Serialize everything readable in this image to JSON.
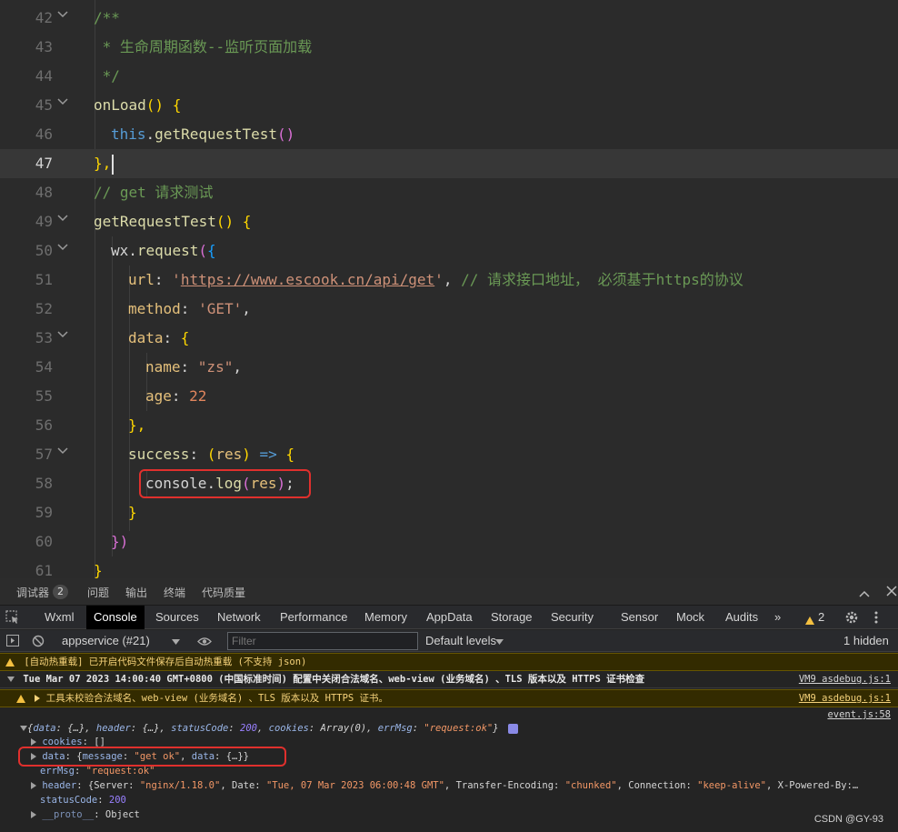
{
  "editor": {
    "lines": [
      {
        "num": "42",
        "folded": true
      },
      {
        "num": "43"
      },
      {
        "num": "44"
      },
      {
        "num": "45",
        "folded": true
      },
      {
        "num": "46"
      },
      {
        "num": "47",
        "current": true
      },
      {
        "num": "48"
      },
      {
        "num": "49",
        "folded": true
      },
      {
        "num": "50",
        "folded": true
      },
      {
        "num": "51"
      },
      {
        "num": "52"
      },
      {
        "num": "53",
        "folded": true
      },
      {
        "num": "54"
      },
      {
        "num": "55"
      },
      {
        "num": "56"
      },
      {
        "num": "57",
        "folded": true
      },
      {
        "num": "58"
      },
      {
        "num": "59"
      },
      {
        "num": "60"
      },
      {
        "num": "61"
      }
    ],
    "code": {
      "l42": "/**",
      "l43": " * 生命周期函数--监听页面加载",
      "l44": " */",
      "l45_fn": "onLoad",
      "l45_rest": "() {",
      "l46_this": "this",
      "l46_fn": "getRequestTest",
      "l46_rest": "()",
      "l47": "},",
      "l48": "// get 请求测试",
      "l49_fn": "getRequestTest",
      "l49_rest": "() {",
      "l50_obj": "wx",
      "l50_fn": "request",
      "l50_rest": "({",
      "l51_key": "url",
      "l51_url": "https://www.escook.cn/api/get",
      "l51_comment": "// 请求接口地址， 必须基于https的协议",
      "l52_key": "method",
      "l52_val": "'GET'",
      "l53_key": "data",
      "l54_key": "name",
      "l54_val": "\"zs\"",
      "l55_key": "age",
      "l55_val": "22",
      "l56": "},",
      "l57_key": "success",
      "l57_param": "res",
      "l58_obj": "console",
      "l58_fn": "log",
      "l58_arg": "res",
      "l59": "}",
      "l60": "})",
      "l61": "}"
    }
  },
  "devtools": {
    "top_tabs": [
      {
        "label": "调试器",
        "active": true
      },
      {
        "label": "问题"
      },
      {
        "label": "输出"
      },
      {
        "label": "终端"
      },
      {
        "label": "代码质量"
      }
    ],
    "debugger_badge": "2",
    "panel_tabs": [
      "Wxml",
      "Console",
      "Sources",
      "Network",
      "Performance",
      "Memory",
      "AppData",
      "Storage",
      "Security",
      "Sensor",
      "Mock",
      "Audits"
    ],
    "active_panel": "Console",
    "more_tabs": "»",
    "warning_count": "2",
    "toolbar": {
      "context": "appservice (#21)",
      "filter_placeholder": "Filter",
      "levels": "Default levels",
      "hidden": "1 hidden"
    },
    "console": {
      "msg1": "[自动热重载] 已开启代码文件保存后自动热重载 (不支持 json)",
      "msg2": "Tue Mar 07 2023 14:00:40 GMT+0800 (中国标准时间) 配置中关闭合法域名、web-view (业务域名) 、TLS 版本以及 HTTPS 证书检查",
      "msg2_src": "VM9 asdebug.js:1",
      "msg3": "工具未校验合法域名、web-view (业务域名) 、TLS 版本以及 HTTPS 证书。",
      "msg3_src": "VM9 asdebug.js:1",
      "event_src": "event.js:58",
      "obj_summary": {
        "open": "{",
        "data_k": "data",
        "data_v": "{…}",
        "header_k": "header",
        "header_v": "{…}",
        "status_k": "statusCode",
        "status_v": "200",
        "cookies_k": "cookies",
        "cookies_v": "Array(0)",
        "err_k": "errMsg",
        "err_v": "\"request:ok\"",
        "close": "}"
      },
      "props": {
        "cookies_k": "cookies",
        "cookies_v": "[]",
        "data_k": "data",
        "data_msg_k": "message",
        "data_msg_v": "\"get ok\"",
        "data_data_k": "data",
        "data_data_v": "{…}",
        "err_k": "errMsg",
        "err_v": "\"request:ok\"",
        "header_k": "header",
        "h_server_k": "Server",
        "h_server_v": "\"nginx/1.18.0\"",
        "h_date_k": "Date",
        "h_date_v": "\"Tue, 07 Mar 2023 06:00:48 GMT\"",
        "h_te_k": "Transfer-Encoding",
        "h_te_v": "\"chunked\"",
        "h_conn_k": "Connection",
        "h_conn_v": "\"keep-alive\"",
        "h_xpb_k": "X-Powered-By:…",
        "status_k": "statusCode",
        "status_v": "200",
        "proto_k": "__proto__",
        "proto_v": "Object"
      }
    }
  },
  "watermark": "CSDN @GY-93"
}
